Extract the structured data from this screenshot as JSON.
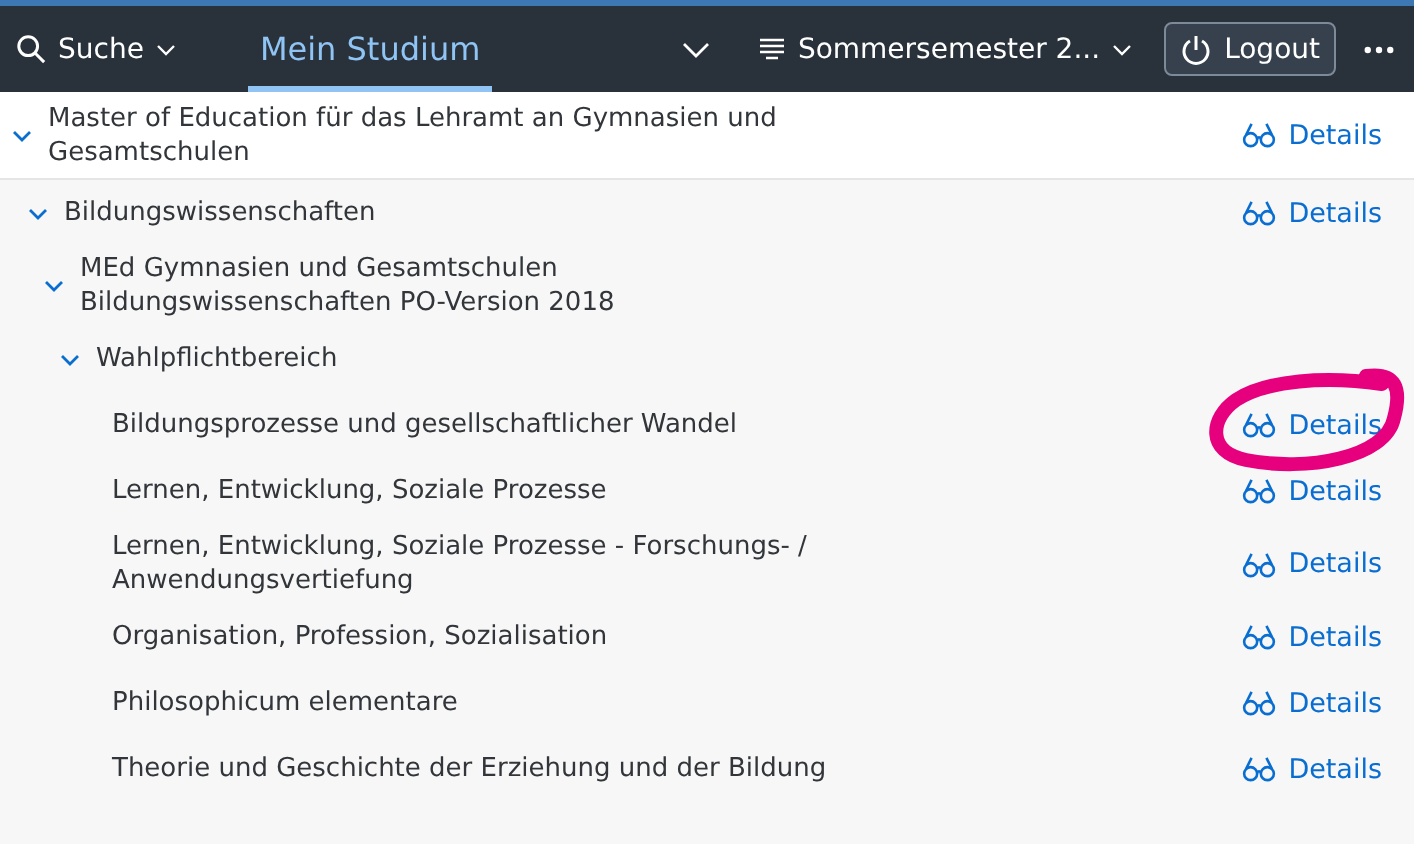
{
  "header": {
    "search": {
      "label": "Suche"
    },
    "tabs": [
      {
        "label": "Mein Studium",
        "selected": true
      }
    ],
    "semester": "Sommersemester 2...",
    "logout": "Logout"
  },
  "tree": [
    {
      "label": "Master of Education für das Lehramt an Gymnasien und Gesamtschulen",
      "details": "Details",
      "circled": false,
      "expanded": true,
      "children": [
        {
          "label": "Bildungswissenschaften",
          "details": "Details",
          "circled": false,
          "expanded": true,
          "children": [
            {
              "label": "MEd Gymnasien und Gesamtschulen Bildungswissenschaften PO-Version 2018",
              "circled": false,
              "expanded": true,
              "children": [
                {
                  "label": "Wahlpflichtbereich",
                  "circled": false,
                  "expanded": true,
                  "children": [
                    {
                      "label": "Bildungsprozesse und gesellschaftlicher Wandel",
                      "details": "Details",
                      "circled": true
                    },
                    {
                      "label": "Lernen, Entwicklung, Soziale Prozesse",
                      "details": "Details",
                      "circled": false
                    },
                    {
                      "label": "Lernen, Entwicklung, Soziale Prozesse - Forschungs- / Anwendungsvertiefung",
                      "details": "Details",
                      "circled": false
                    },
                    {
                      "label": "Organisation, Profession, Sozialisation",
                      "details": "Details",
                      "circled": false
                    },
                    {
                      "label": "Philosophicum elementare",
                      "details": "Details",
                      "circled": false
                    },
                    {
                      "label": "Theorie und Geschichte der Erziehung und der Bildung",
                      "details": "Details",
                      "circled": false
                    }
                  ]
                }
              ]
            }
          ]
        }
      ]
    }
  ]
}
